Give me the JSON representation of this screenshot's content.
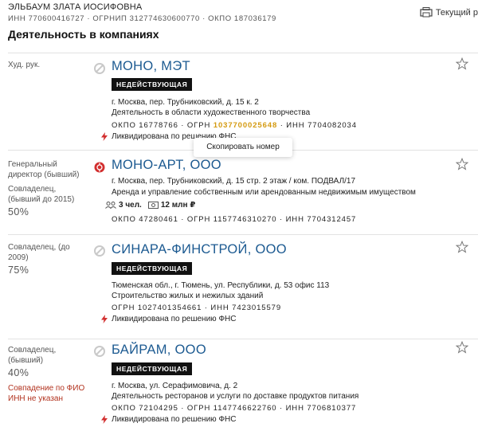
{
  "header": {
    "person_name": "ЭЛЬБАУМ ЗЛАТА ИОСИФОВНА",
    "person_ids": "ИНН 770600416727 · ОГРНИП 312774630600770 · ОКПО 187036179",
    "print_label": "Текущий р",
    "section_title": "Деятельность в компаниях"
  },
  "tooltip": "Скопировать номер",
  "cards": [
    {
      "role": "Худ. рук.",
      "name": "МОНО, МЭТ",
      "badge": "НЕДЕЙСТВУЮЩАЯ",
      "address": "г. Москва, пер. Трубниковский, д. 15 к. 2",
      "activity": "Деятельность в области художественного творчества",
      "codes_prefix": "ОКПО 16778766 · ОГРН ",
      "ogrn_highlighted": "1037700025648",
      "codes_suffix": " · ИНН 7704082034",
      "liquidation": "Ликвидирована по решению ФНС"
    },
    {
      "role": "Генеральный директор (бывший)",
      "role2": "Совладелец, (бывший до 2015)",
      "share": "50%",
      "name": "МОНО-АРТ, ООО",
      "address": "г. Москва, пер. Трубниковский, д. 15 стр. 2 этаж / ком. ПОДВАЛ/17",
      "activity": "Аренда и управление собственным или арендованным недвижимым имуществом",
      "employees": "3 чел.",
      "revenue": "12 млн ₽",
      "codes": "ОКПО 47280461 · ОГРН 1157746310270 · ИНН 7704312457"
    },
    {
      "role": "Совладелец, (до 2009)",
      "share": "75%",
      "name": "СИНАРА-ФИНСТРОЙ, ООО",
      "badge": "НЕДЕЙСТВУЮЩАЯ",
      "address": "Тюменская обл., г. Тюмень, ул. Республики, д. 53 офис 113",
      "activity": "Строительство жилых и нежилых зданий",
      "codes": "ОГРН 1027401354661 · ИНН 7423015579",
      "liquidation": "Ликвидирована по решению ФНС"
    },
    {
      "role": "Совладелец, (бывший)",
      "share": "40%",
      "warning": "Совпадение по ФИО ИНН не указан",
      "name": "БАЙРАМ, ООО",
      "badge": "НЕДЕЙСТВУЮЩАЯ",
      "address": "г. Москва, ул. Серафимовича, д. 2",
      "activity": "Деятельность ресторанов и услуги по доставке продуктов питания",
      "codes": "ОКПО 72104295 · ОГРН 1147746622760 · ИНН 7706810377",
      "liquidation": "Ликвидирована по решению ФНС"
    }
  ],
  "colors": {
    "link": "#1c5a91",
    "highlight": "#d49a10",
    "warning": "#b2331f",
    "active_status": "#d22e2e",
    "inactive_status": "#c9c9c9"
  },
  "icons": [
    "print-icon",
    "inactive-status-icon",
    "active-alert-icon",
    "star-icon",
    "bolt-icon",
    "people-icon",
    "money-icon"
  ]
}
